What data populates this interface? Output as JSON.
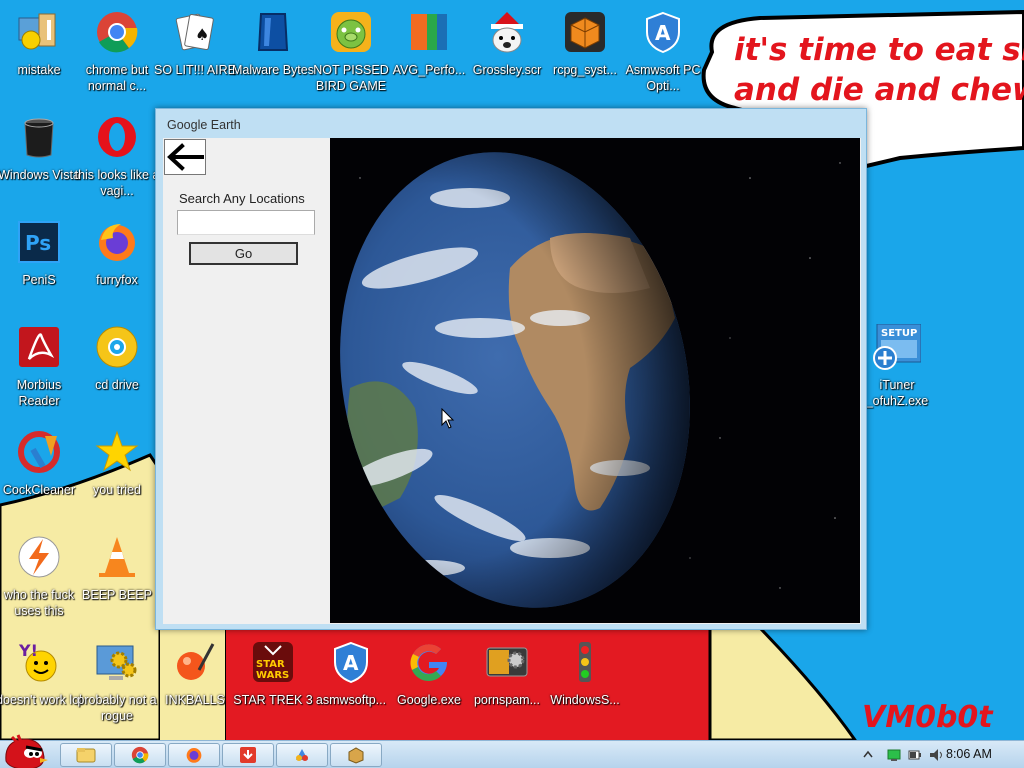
{
  "wallpaper": {
    "bubble_text": "it's time to eat shit\nand die and chew\num",
    "signature": "VM0b0t"
  },
  "desktop_icons": [
    {
      "label": "mistake",
      "icon": "control-panel-icon"
    },
    {
      "label": "chrome but normal c...",
      "icon": "chrome-icon"
    },
    {
      "label": "SO LIT!!! AIRE",
      "icon": "solitaire-cards-icon"
    },
    {
      "label": "Malware Bytes",
      "icon": "malwarebytes-icon"
    },
    {
      "label": "NOT PISSED BIRD GAME",
      "icon": "green-pig-icon"
    },
    {
      "label": "AVG_Perfo...",
      "icon": "avg-icon"
    },
    {
      "label": "Grossley.scr",
      "icon": "dog-santa-hat-icon"
    },
    {
      "label": "rcpg_syst...",
      "icon": "cube-icon"
    },
    {
      "label": "Asmwsoft PC Opti...",
      "icon": "asmwsoft-shield-icon"
    },
    {
      "label": "Windows Vista",
      "icon": "trash-bin-icon"
    },
    {
      "label": "this looks like a vagi...",
      "icon": "opera-icon"
    },
    {
      "label": "PeniS",
      "icon": "photoshop-icon"
    },
    {
      "label": "furryfox",
      "icon": "firefox-icon"
    },
    {
      "label": "Morbius Reader",
      "icon": "pdf-reader-icon"
    },
    {
      "label": "cd drive",
      "icon": "cd-icon"
    },
    {
      "label": "CockCleaner",
      "icon": "ccleaner-icon"
    },
    {
      "label": "you tried",
      "icon": "star-icon"
    },
    {
      "label": "who the fuck uses this",
      "icon": "avast-icon"
    },
    {
      "label": "BEEP BEEP",
      "icon": "traffic-cone-icon"
    },
    {
      "label": "doesn't work lol",
      "icon": "yahoo-messenger-icon"
    },
    {
      "label": "probably not a rogue",
      "icon": "gears-monitor-icon"
    },
    {
      "label": "INKBALLS",
      "icon": "inkball-icon"
    },
    {
      "label": "STAR TREK 3",
      "icon": "star-wars-icon"
    },
    {
      "label": "asmwsoftp...",
      "icon": "asmwsoft-shield-icon"
    },
    {
      "label": "Google.exe",
      "icon": "google-g-icon"
    },
    {
      "label": "pornspam...",
      "icon": "gear-box-icon"
    },
    {
      "label": "WindowsS...",
      "icon": "traffic-light-icon"
    },
    {
      "label": "iTuner _ofuhZ.exe",
      "icon": "setup-installer-icon"
    }
  ],
  "window": {
    "title": "Google Earth",
    "search_label": "Search Any Locations",
    "search_value": "",
    "go_label": "Go"
  },
  "taskbar": {
    "clock": "8:06 AM",
    "buttons": [
      "explorer-icon",
      "chrome-icon",
      "firefox-icon",
      "download-icon",
      "paint-icon",
      "box-icon"
    ]
  },
  "colors": {
    "desktop_blue": "#1aa6ea",
    "accent_red": "#e3151d",
    "sand": "#f6eba4"
  }
}
